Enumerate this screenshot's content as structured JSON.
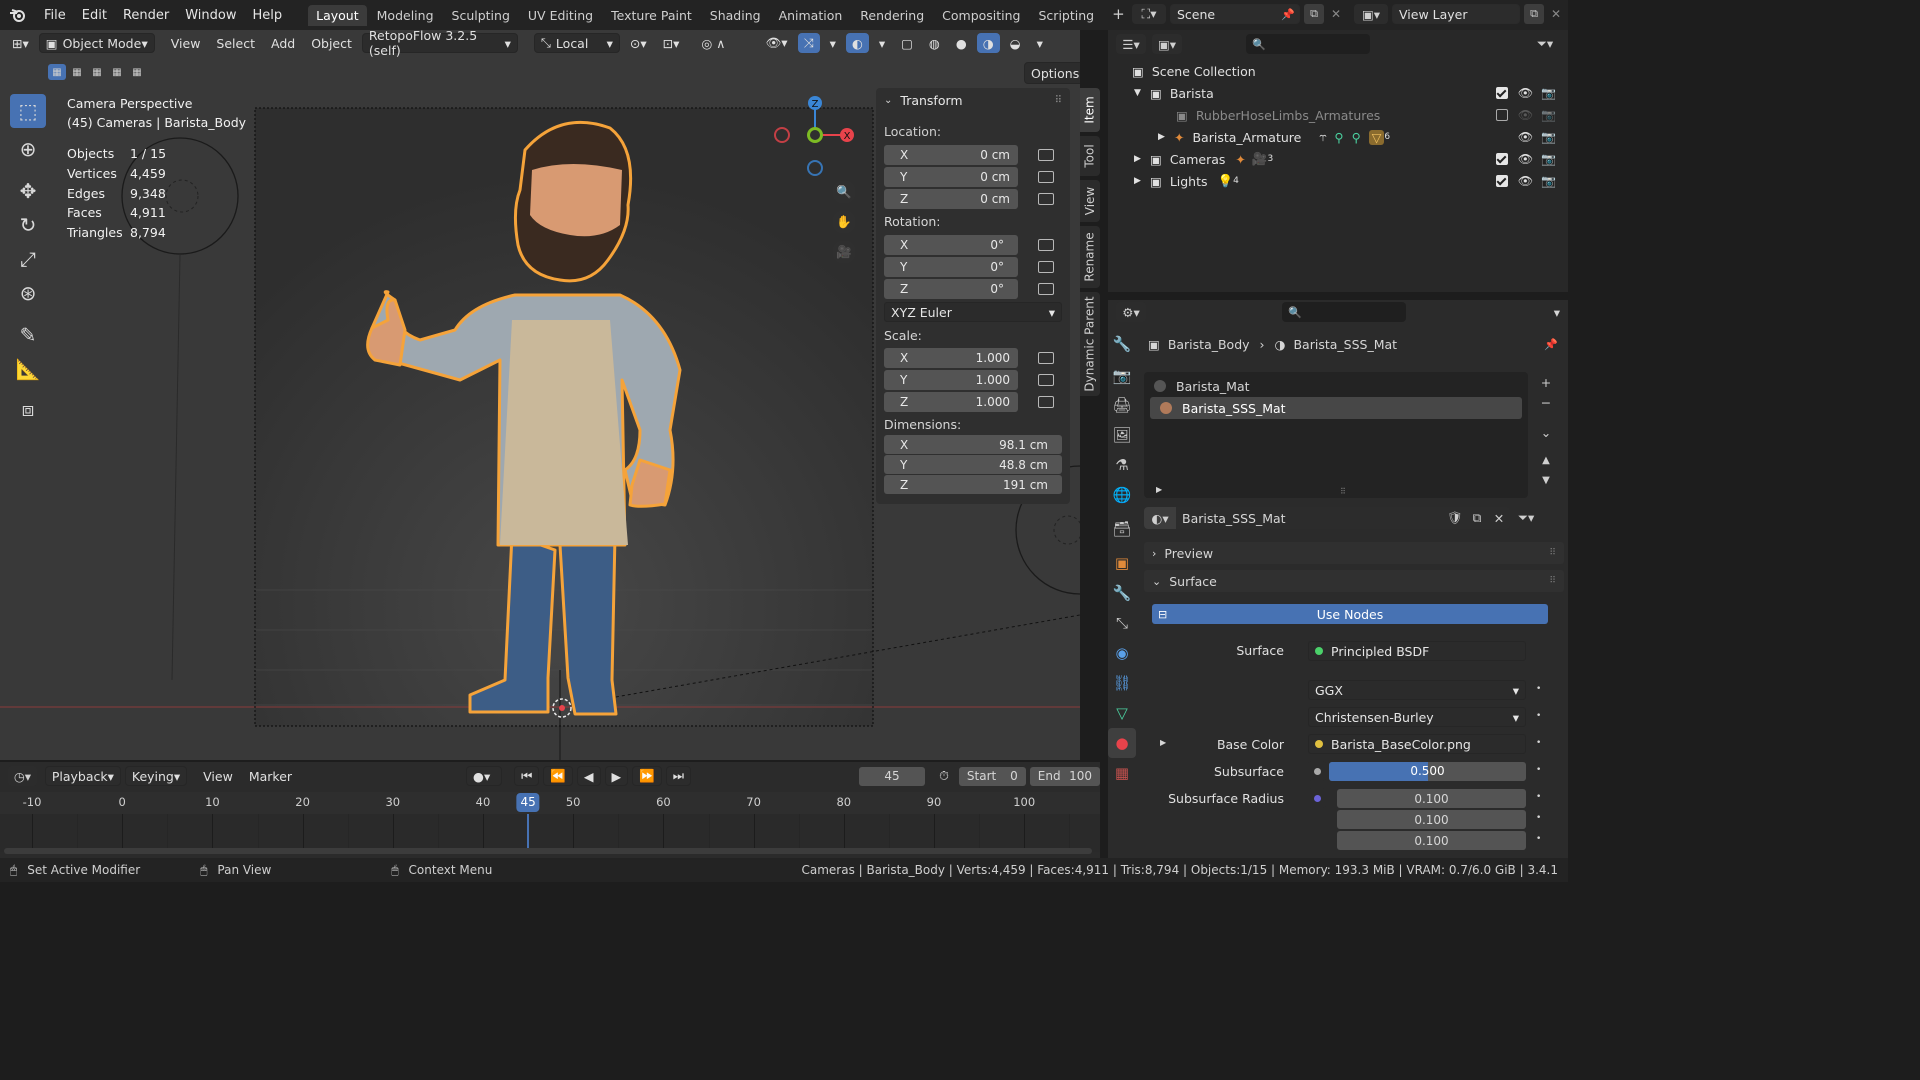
{
  "menu": {
    "file": "File",
    "edit": "Edit",
    "render": "Render",
    "window": "Window",
    "help": "Help"
  },
  "workspaces": [
    "Layout",
    "Modeling",
    "Sculpting",
    "UV Editing",
    "Texture Paint",
    "Shading",
    "Animation",
    "Rendering",
    "Compositing",
    "Scripting"
  ],
  "scene": {
    "scene_name": "Scene",
    "view_layer": "View Layer"
  },
  "viewport_header": {
    "mode": "Object Mode",
    "view": "View",
    "select": "Select",
    "add": "Add",
    "object": "Object",
    "addon": "RetopoFlow 3.2.5 (self)",
    "transform_space": "Local",
    "options": "Options"
  },
  "overlay": {
    "title": "Camera Perspective",
    "subtitle": "(45) Cameras | Barista_Body",
    "stats": [
      {
        "label": "Objects",
        "value": "1 / 15"
      },
      {
        "label": "Vertices",
        "value": "4,459"
      },
      {
        "label": "Edges",
        "value": "9,348"
      },
      {
        "label": "Faces",
        "value": "4,911"
      },
      {
        "label": "Triangles",
        "value": "8,794"
      }
    ]
  },
  "gizmo": {
    "z": "Z",
    "x": "X"
  },
  "transform": {
    "title": "Transform",
    "location_label": "Location:",
    "location": [
      {
        "axis": "X",
        "value": "0 cm"
      },
      {
        "axis": "Y",
        "value": "0 cm"
      },
      {
        "axis": "Z",
        "value": "0 cm"
      }
    ],
    "rotation_label": "Rotation:",
    "rotation": [
      {
        "axis": "X",
        "value": "0°"
      },
      {
        "axis": "Y",
        "value": "0°"
      },
      {
        "axis": "Z",
        "value": "0°"
      }
    ],
    "rotation_mode": "XYZ Euler",
    "scale_label": "Scale:",
    "scale": [
      {
        "axis": "X",
        "value": "1.000"
      },
      {
        "axis": "Y",
        "value": "1.000"
      },
      {
        "axis": "Z",
        "value": "1.000"
      }
    ],
    "dimensions_label": "Dimensions:",
    "dimensions": [
      {
        "axis": "X",
        "value": "98.1 cm"
      },
      {
        "axis": "Y",
        "value": "48.8 cm"
      },
      {
        "axis": "Z",
        "value": "191 cm"
      }
    ]
  },
  "side_tabs": [
    "Item",
    "Tool",
    "View",
    "Rename",
    "Dynamic Parent"
  ],
  "outliner": {
    "root": "Scene Collection",
    "items": [
      {
        "label": "Barista"
      },
      {
        "label": "RubberHoseLimbs_Armatures"
      },
      {
        "label": "Barista_Armature",
        "badge": "6"
      },
      {
        "label": "Cameras",
        "badge": "3"
      },
      {
        "label": "Lights",
        "badge": "4"
      }
    ]
  },
  "properties": {
    "breadcrumb_object": "Barista_Body",
    "breadcrumb_material": "Barista_SSS_Mat",
    "slots": [
      "Barista_Mat",
      "Barista_SSS_Mat"
    ],
    "material_name": "Barista_SSS_Mat",
    "preview": "Preview",
    "surface_section": "Surface",
    "use_nodes": "Use Nodes",
    "surface_label": "Surface",
    "surface_value": "Principled BSDF",
    "distribution": "GGX",
    "sss_method": "Christensen-Burley",
    "base_color_label": "Base Color",
    "base_color_value": "Barista_BaseColor.png",
    "subsurface_label": "Subsurface",
    "subsurface_value": "0.500",
    "subsurface_fraction": 0.5,
    "subsurface_radius_label": "Subsurface Radius",
    "subsurface_radius": [
      "0.100",
      "0.100",
      "0.100"
    ]
  },
  "timeline": {
    "playback": "Playback",
    "keying": "Keying",
    "view": "View",
    "marker": "Marker",
    "current_frame": "45",
    "start_label": "Start",
    "start": "0",
    "end_label": "End",
    "end": "100",
    "ticks": [
      "-10",
      "0",
      "10",
      "20",
      "30",
      "40",
      "50",
      "60",
      "70",
      "80",
      "90",
      "100"
    ],
    "playhead": "45"
  },
  "statusbar": {
    "left1": "Set Active Modifier",
    "left2": "Pan View",
    "left3": "Context Menu",
    "right": "Cameras | Barista_Body | Verts:4,459 | Faces:4,911 | Tris:8,794 | Objects:1/15 | Memory: 193.3 MiB | VRAM: 0.7/6.0 GiB | 3.4.1"
  },
  "colors": {
    "accent": "#4772b3",
    "selection": "#f5a33a",
    "axis_x": "#e8434b",
    "axis_y": "#7dbb24",
    "axis_z": "#3a86d6"
  }
}
